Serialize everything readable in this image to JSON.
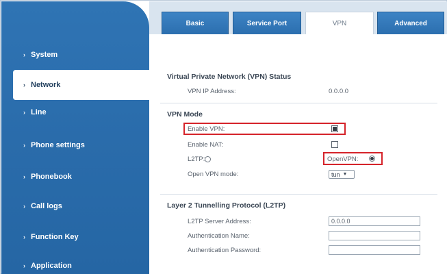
{
  "sidebar": {
    "items": [
      {
        "label": "System"
      },
      {
        "label": "Network",
        "active": true
      },
      {
        "label": "Line"
      },
      {
        "label": "Phone settings"
      },
      {
        "label": "Phonebook"
      },
      {
        "label": "Call logs"
      },
      {
        "label": "Function Key"
      },
      {
        "label": "Application"
      }
    ],
    "chevron": "›"
  },
  "tabs": [
    {
      "label": "Basic"
    },
    {
      "label": "Service Port"
    },
    {
      "label": "VPN",
      "active": true
    },
    {
      "label": "Advanced"
    }
  ],
  "vpn_status": {
    "title": "Virtual Private Network (VPN) Status",
    "ip_label": "VPN IP Address:",
    "ip_value": "0.0.0.0"
  },
  "vpn_mode": {
    "title": "VPN Mode",
    "enable_vpn_label": "Enable VPN:",
    "enable_vpn_checked": true,
    "enable_nat_label": "Enable NAT:",
    "enable_nat_checked": false,
    "l2tp_label": "L2TP:",
    "openvpn_label": "OpenVPN:",
    "openvpn_selected": true,
    "open_vpn_mode_label": "Open VPN mode:",
    "open_vpn_mode_value": "tun"
  },
  "l2tp": {
    "title": "Layer 2 Tunnelling Protocol (L2TP)",
    "server_label": "L2TP Server Address:",
    "server_value": "0.0.0.0",
    "auth_name_label": "Authentication Name:",
    "auth_name_value": "",
    "auth_password_label": "Authentication Password:",
    "auth_password_value": ""
  },
  "colors": {
    "sidebar_blue": "#2a6cab",
    "highlight_red": "#d5232a",
    "tab_blue": "#2b6eae"
  }
}
